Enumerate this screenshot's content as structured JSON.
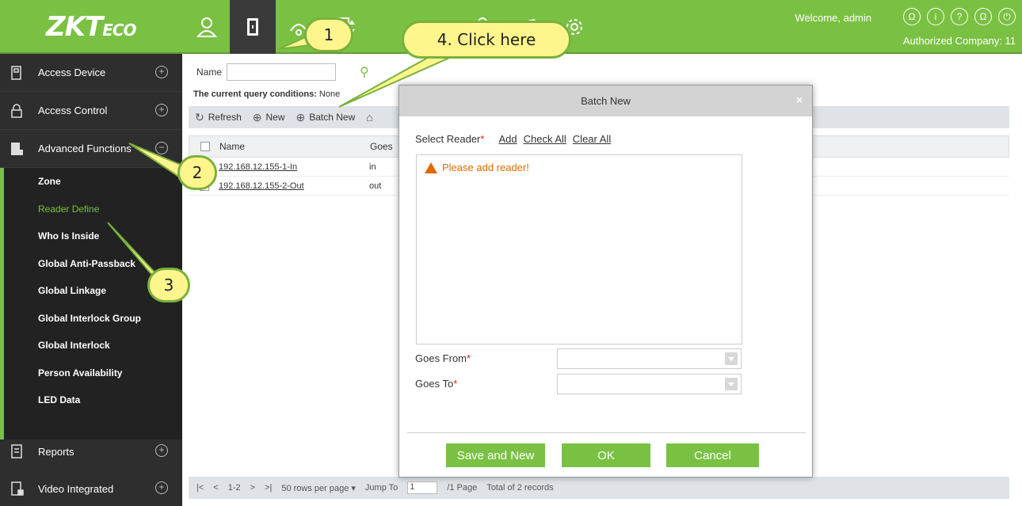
{
  "topbar": {
    "logo_main": "ZKT",
    "logo_sub": "ECO",
    "welcome": "Welcome, admin",
    "company": "Authorized Company: 11",
    "module_icons": [
      "personnel-icon",
      "access-icon",
      "attendance-icon",
      "elevator-icon",
      "visitor-icon",
      "video-icon",
      "system-icon"
    ]
  },
  "sidebar": {
    "sections": [
      {
        "label": "Access Device"
      },
      {
        "label": "Access Control"
      },
      {
        "label": "Advanced Functions"
      }
    ],
    "submenu": [
      "Zone",
      "Reader Define",
      "Who Is Inside",
      "Global Anti-Passback",
      "Global Linkage",
      "Global Interlock Group",
      "Global Interlock",
      "Person Availability",
      "LED Data"
    ],
    "bottom": [
      {
        "label": "Reports"
      },
      {
        "label": "Video Integrated"
      }
    ]
  },
  "main": {
    "name_label": "Name",
    "conditions_label": "The current query conditions:",
    "conditions_value": "None",
    "toolbar": {
      "refresh": "Refresh",
      "new": "New",
      "batch_new": "Batch New"
    },
    "columns": [
      "Name",
      "Goes"
    ],
    "rows": [
      {
        "name": "192.168.12.155-1-In",
        "goes": "in"
      },
      {
        "name": "192.168.12.155-2-Out",
        "goes": "out"
      }
    ],
    "footer": {
      "range": "1-2",
      "per_page": "50 rows per page",
      "jump_label": "Jump To",
      "jump_value": "1",
      "pages": "/1 Page",
      "total": "Total of 2 records"
    }
  },
  "dialog": {
    "title": "Batch New",
    "close": "×",
    "select_reader": "Select Reader",
    "add": "Add",
    "check_all": "Check All",
    "clear_all": "Clear All",
    "warning": "Please add reader!",
    "goes_from": "Goes From",
    "goes_to": "Goes To",
    "save_new": "Save and New",
    "ok": "OK",
    "cancel": "Cancel"
  },
  "callouts": {
    "one": "1",
    "two": "2",
    "three": "3",
    "four": "4. Click here"
  },
  "colors": {
    "accent": "#7ac143",
    "sidebar": "#2e2e2e",
    "warning": "#e06a00"
  }
}
